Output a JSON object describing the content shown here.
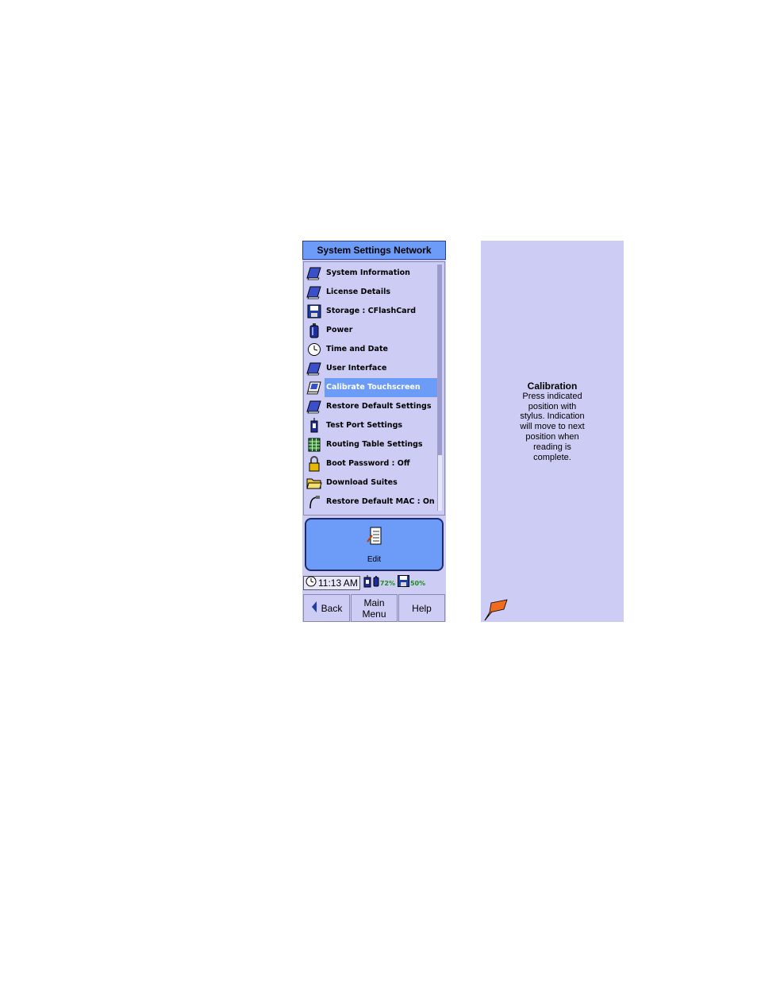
{
  "window": {
    "title": "System Settings Network"
  },
  "menu": {
    "items": [
      {
        "label": "System Information",
        "icon": "book-icon"
      },
      {
        "label": "License Details",
        "icon": "book-icon"
      },
      {
        "label": "Storage : CFlashCard",
        "icon": "floppy-disk-icon"
      },
      {
        "label": "Power",
        "icon": "battery-icon"
      },
      {
        "label": "Time and Date",
        "icon": "clock-icon"
      },
      {
        "label": "User Interface",
        "icon": "book-icon"
      },
      {
        "label": "Calibrate Touchscreen",
        "icon": "touchscreen-icon",
        "selected": true
      },
      {
        "label": "Restore Default Settings",
        "icon": "book-icon"
      },
      {
        "label": "Test Port Settings",
        "icon": "port-icon"
      },
      {
        "label": "Routing Table Settings",
        "icon": "table-icon"
      },
      {
        "label": "Boot Password : Off",
        "icon": "padlock-icon"
      },
      {
        "label": "Download Suites",
        "icon": "folder-icon"
      },
      {
        "label": "Restore Default MAC : On",
        "icon": "cable-icon"
      }
    ]
  },
  "edit_panel": {
    "label": "Edit",
    "icon": "edit-document-icon"
  },
  "status": {
    "time": "11:13 AM",
    "battery_percent": "72%",
    "storage_percent": "50%"
  },
  "nav": {
    "back_label": "Back",
    "main_menu_line1": "Main",
    "main_menu_line2": "Menu",
    "help_label": "Help"
  },
  "help": {
    "title": "Calibration",
    "body": "Press indicated position with stylus. Indication will move to next position when reading is complete."
  },
  "colors": {
    "panel_bg": "#ccccf5",
    "accent_blue": "#6d9cf8",
    "status_green": "#1b8f1b",
    "pen_orange": "#f06a1f"
  }
}
